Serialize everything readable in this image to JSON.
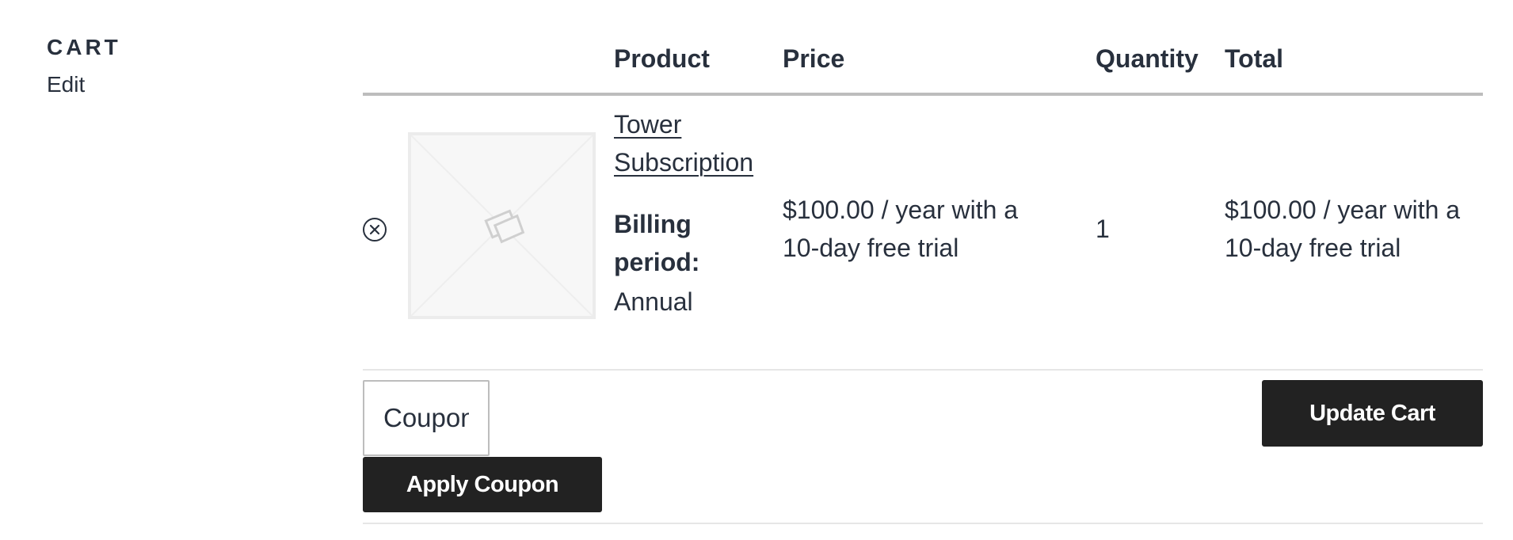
{
  "sidebar": {
    "heading": "CART",
    "edit_label": "Edit"
  },
  "table": {
    "headers": {
      "product": "Product",
      "price": "Price",
      "quantity": "Quantity",
      "total": "Total"
    },
    "rows": [
      {
        "remove_icon": "close-circle-icon",
        "thumbnail_icon": "placeholder-image-icon",
        "product_name": "Tower Subscription",
        "billing_label": "Billing period:",
        "billing_value": "Annual",
        "price": "$100.00 / year with a 10-day free trial",
        "quantity": "1",
        "total": "$100.00 / year with a 10-day free trial"
      }
    ]
  },
  "actions": {
    "coupon_placeholder": "Coupon code",
    "apply_label": "Apply Coupon",
    "update_label": "Update Cart"
  },
  "colors": {
    "text": "#28303d",
    "button_bg": "#222222",
    "button_text": "#ffffff",
    "header_rule": "#bdbdbd",
    "row_rule": "#e6e6e6",
    "thumb_bg": "#f7f7f7"
  }
}
